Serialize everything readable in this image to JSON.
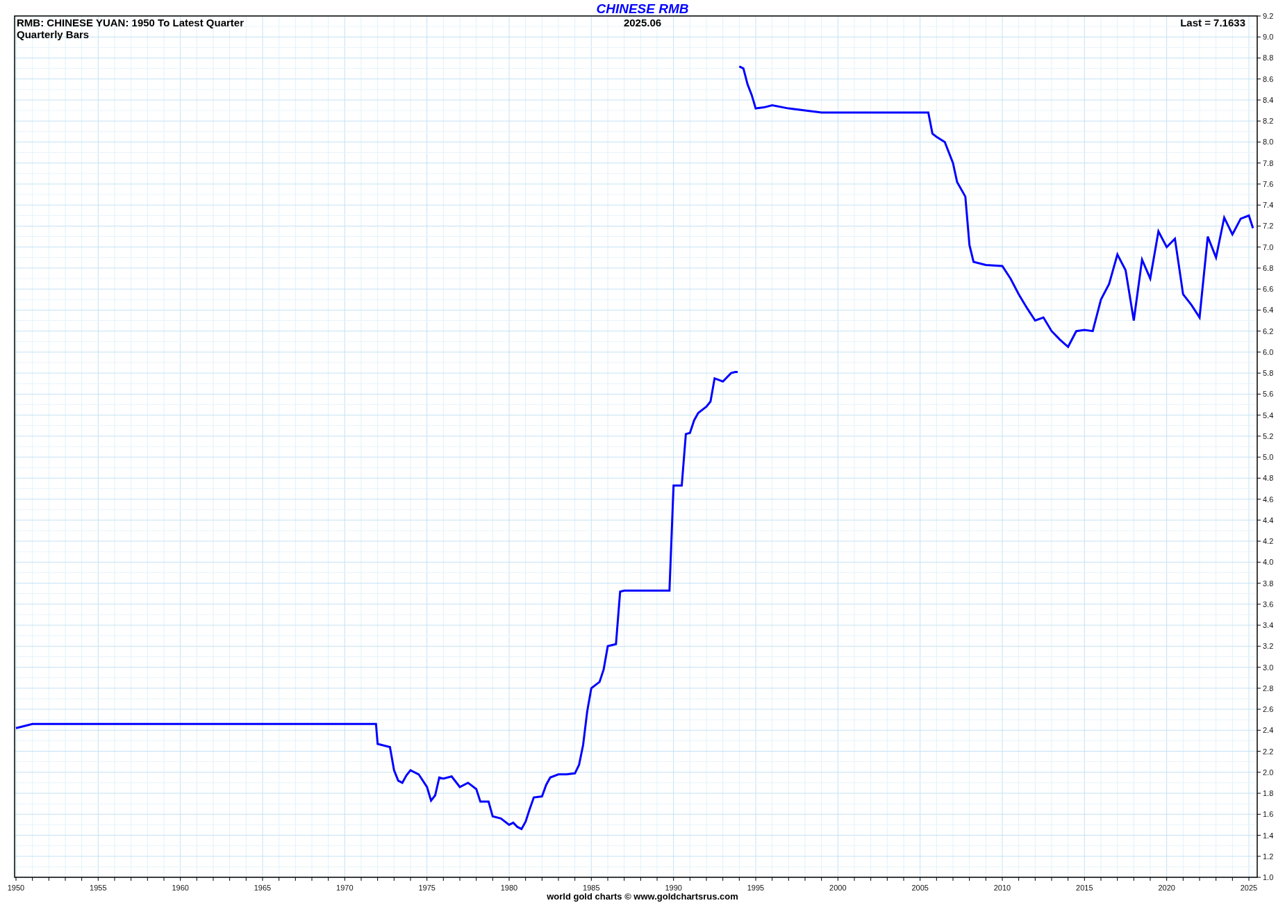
{
  "chart": {
    "subtitle_lines": [
      "RMB: CHINESE YUAN: 1950 To Latest Quarter",
      "Quarterly Bars"
    ],
    "date": "2025.06",
    "last": "Last = 7.1633",
    "footer": "world gold charts © www.goldchartsrus.com",
    "chart_data": {
      "type": "line",
      "title": "CHINESE RMB",
      "x": [
        1950,
        1951,
        1955,
        1960,
        1965,
        1970,
        1971.9,
        1972,
        1972.75,
        1973,
        1973.25,
        1973.5,
        1973.75,
        1974,
        1974.5,
        1975,
        1975.25,
        1975.5,
        1975.75,
        1976,
        1976.5,
        1977,
        1977.5,
        1978,
        1978.25,
        1978.75,
        1979,
        1979.5,
        1980,
        1980.25,
        1980.5,
        1980.75,
        1981,
        1981.25,
        1981.5,
        1982,
        1982.25,
        1982.5,
        1983,
        1983.5,
        1984,
        1984.25,
        1984.5,
        1984.75,
        1985,
        1985.5,
        1985.75,
        1986,
        1986.5,
        1986.75,
        1987,
        1988,
        1989,
        1989.75,
        1990,
        1990.5,
        1990.75,
        1991,
        1991.25,
        1991.5,
        1992,
        1992.25,
        1992.5,
        1993,
        1993.5,
        1993.75,
        1993.9,
        1994,
        1994.25,
        1994.5,
        1994.75,
        1995,
        1995.5,
        1996,
        1997,
        1998,
        1999,
        2000,
        2002,
        2004,
        2005.5,
        2005.75,
        2006,
        2006.5,
        2007,
        2007.25,
        2007.75,
        2008,
        2008.25,
        2009,
        2010,
        2010.5,
        2011,
        2011.5,
        2012,
        2012.5,
        2013,
        2013.5,
        2014,
        2014.5,
        2015,
        2015.5,
        2016,
        2016.5,
        2017,
        2017.5,
        2018,
        2018.5,
        2019,
        2019.5,
        2020,
        2020.5,
        2021,
        2021.5,
        2022,
        2022.5,
        2023,
        2023.5,
        2024,
        2024.5,
        2025,
        2025.25
      ],
      "series": [
        {
          "color": "#0000ff",
          "values": [
            2.42,
            2.46,
            2.46,
            2.46,
            2.46,
            2.46,
            2.46,
            2.27,
            2.24,
            2.02,
            1.92,
            1.9,
            1.97,
            2.02,
            1.98,
            1.86,
            1.73,
            1.78,
            1.95,
            1.94,
            1.96,
            1.86,
            1.9,
            1.84,
            1.72,
            1.72,
            1.58,
            1.56,
            1.5,
            1.52,
            1.48,
            1.46,
            1.53,
            1.65,
            1.76,
            1.77,
            1.88,
            1.95,
            1.98,
            1.98,
            1.99,
            2.07,
            2.26,
            2.58,
            2.8,
            2.86,
            2.98,
            3.2,
            3.22,
            3.72,
            3.73,
            3.73,
            3.73,
            3.73,
            4.73,
            4.73,
            5.22,
            5.23,
            5.35,
            5.42,
            5.48,
            5.53,
            5.75,
            5.72,
            5.8,
            5.81,
            null,
            8.72,
            8.7,
            8.55,
            8.45,
            8.32,
            8.33,
            8.35,
            8.32,
            8.3,
            8.28,
            8.28,
            8.28,
            8.28,
            8.28,
            8.08,
            8.05,
            8.0,
            7.8,
            7.62,
            7.48,
            7.02,
            6.86,
            6.83,
            6.82,
            6.7,
            6.55,
            6.42,
            6.3,
            6.33,
            6.2,
            6.12,
            6.05,
            6.2,
            6.21,
            6.2,
            6.5,
            6.65,
            6.93,
            6.78,
            6.3,
            6.88,
            6.7,
            7.15,
            7.0,
            7.08,
            6.55,
            6.45,
            6.33,
            7.1,
            6.9,
            7.28,
            7.12,
            7.27,
            7.3,
            7.18
          ]
        }
      ],
      "grid": true,
      "xlim": [
        1950,
        2025.5
      ],
      "ylim": [
        1.0,
        9.2
      ],
      "xticks": [
        1950,
        1955,
        1960,
        1965,
        1970,
        1975,
        1980,
        1985,
        1990,
        1995,
        2000,
        2005,
        2010,
        2015,
        2020,
        2025
      ],
      "yticks": [
        {
          "value": 1.0,
          "label": "1.0"
        },
        {
          "value": 1.2,
          "label": "1.2"
        },
        {
          "value": 1.4,
          "label": "1.4"
        },
        {
          "value": 1.6,
          "label": "1.6"
        },
        {
          "value": 1.8,
          "label": "1.8"
        },
        {
          "value": 2.0,
          "label": "2.0"
        },
        {
          "value": 2.2,
          "label": "2.2"
        },
        {
          "value": 2.4,
          "label": "2.4"
        },
        {
          "value": 2.6,
          "label": "2.6"
        },
        {
          "value": 2.8,
          "label": "2.8"
        },
        {
          "value": 3.0,
          "label": "3.0"
        },
        {
          "value": 3.2,
          "label": "3.2"
        },
        {
          "value": 3.4,
          "label": "3.4"
        },
        {
          "value": 3.6,
          "label": "3.6"
        },
        {
          "value": 3.8,
          "label": "3.8"
        },
        {
          "value": 4.0,
          "label": "4.0"
        },
        {
          "value": 4.2,
          "label": "4.2"
        },
        {
          "value": 4.4,
          "label": "4.4"
        },
        {
          "value": 4.6,
          "label": "4.6"
        },
        {
          "value": 4.8,
          "label": "4.8"
        },
        {
          "value": 5.0,
          "label": "5.0"
        },
        {
          "value": 5.2,
          "label": "5.2"
        },
        {
          "value": 5.4,
          "label": "5.4"
        },
        {
          "value": 5.6,
          "label": "5.6"
        },
        {
          "value": 5.8,
          "label": "5.8"
        },
        {
          "value": 6.0,
          "label": "6.0"
        },
        {
          "value": 6.2,
          "label": "6.2"
        },
        {
          "value": 6.4,
          "label": "6.4"
        },
        {
          "value": 6.6,
          "label": "6.6"
        },
        {
          "value": 6.8,
          "label": "6.8"
        },
        {
          "value": 7.0,
          "label": "7.0"
        },
        {
          "value": 7.2,
          "label": "7.2"
        },
        {
          "value": 7.4,
          "label": "7.4"
        },
        {
          "value": 7.6,
          "label": "7.6"
        },
        {
          "value": 7.8,
          "label": "7.8"
        },
        {
          "value": 8.0,
          "label": "8.0"
        },
        {
          "value": 8.2,
          "label": "8.2"
        },
        {
          "value": 8.4,
          "label": "8.4"
        },
        {
          "value": 8.6,
          "label": "8.6"
        },
        {
          "value": 8.8,
          "label": "8.8"
        },
        {
          "value": 9.0,
          "label": "9.0"
        },
        {
          "value": 9.2,
          "label": "9.2"
        }
      ]
    }
  }
}
